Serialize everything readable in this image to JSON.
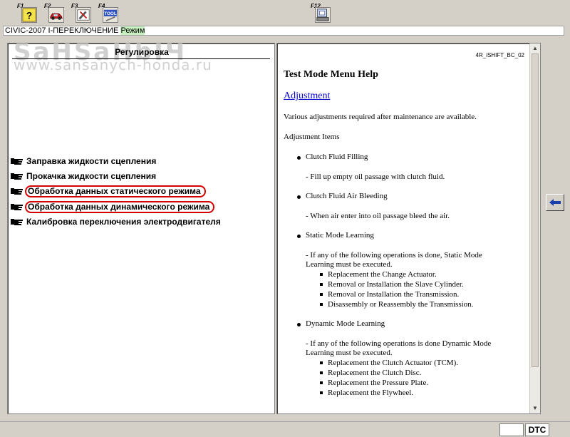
{
  "toolbar": {
    "buttons": [
      {
        "key": "F1",
        "icon": "help-icon"
      },
      {
        "key": "F2",
        "icon": "car-icon"
      },
      {
        "key": "F3",
        "icon": "tools-icon"
      },
      {
        "key": "F4",
        "icon": "tool-box-icon",
        "text": "TOOL"
      },
      {
        "key": "F12",
        "icon": "print-icon"
      }
    ]
  },
  "titlebar": {
    "text": "CIVIC-2007 I-ПЕРЕКЛЮЧЕНИЕ",
    "mode": "Режим"
  },
  "watermark": {
    "line1": "SaHSaHbIЧ",
    "line2": "www.sansanych-honda.ru"
  },
  "left_panel": {
    "heading": "Регулировка",
    "items": [
      {
        "label": "Заправка жидкости сцепления",
        "circled": false
      },
      {
        "label": "Прокачка жидкости сцепления",
        "circled": false
      },
      {
        "label": "Обработка данных статического режима",
        "circled": true
      },
      {
        "label": "Обработка данных динамического режима",
        "circled": true
      },
      {
        "label": "Калибровка переключения электродвигателя",
        "circled": false
      }
    ]
  },
  "help": {
    "code": "4R_iSHIFT_BC_02",
    "title": "Test Mode Menu Help",
    "link": "Adjustment",
    "intro": "Various adjustments required after maintenance are available.",
    "items_heading": "Adjustment Items",
    "sections": [
      {
        "name": "Clutch Fluid Filling",
        "desc": [
          "- Fill up empty oil passage with clutch fluid."
        ],
        "subitems": []
      },
      {
        "name": "Clutch Fluid Air Bleeding",
        "desc": [
          "- When air enter into oil passage bleed the air."
        ],
        "subitems": []
      },
      {
        "name": "Static Mode Learning",
        "desc": [
          "- If any of the following operations is done, Static Mode",
          "Learning must be executed."
        ],
        "subitems": [
          "Replacement the Change Actuator.",
          "Removal or Installation the Slave Cylinder.",
          "Removal or Installation the Transmission.",
          "Disassembly or Reassembly the Transmission."
        ]
      },
      {
        "name": "Dynamic Mode Learning",
        "desc": [
          "- If any of the following operations is done Dynamic Mode",
          "Learning must be executed."
        ],
        "subitems": [
          "Replacement the Clutch Actuator (TCM).",
          "Replacement the Clutch Disc.",
          "Replacement the Pressure Plate.",
          "Replacement the Flywheel."
        ]
      }
    ]
  },
  "statusbar": {
    "dtc_label": "DTC"
  },
  "colors": {
    "background": "#d4d0c8",
    "circle_highlight": "#d40000",
    "link": "#0000cc",
    "mode_highlight": "#c7f0c0",
    "back_arrow": "#1a3fa8"
  }
}
